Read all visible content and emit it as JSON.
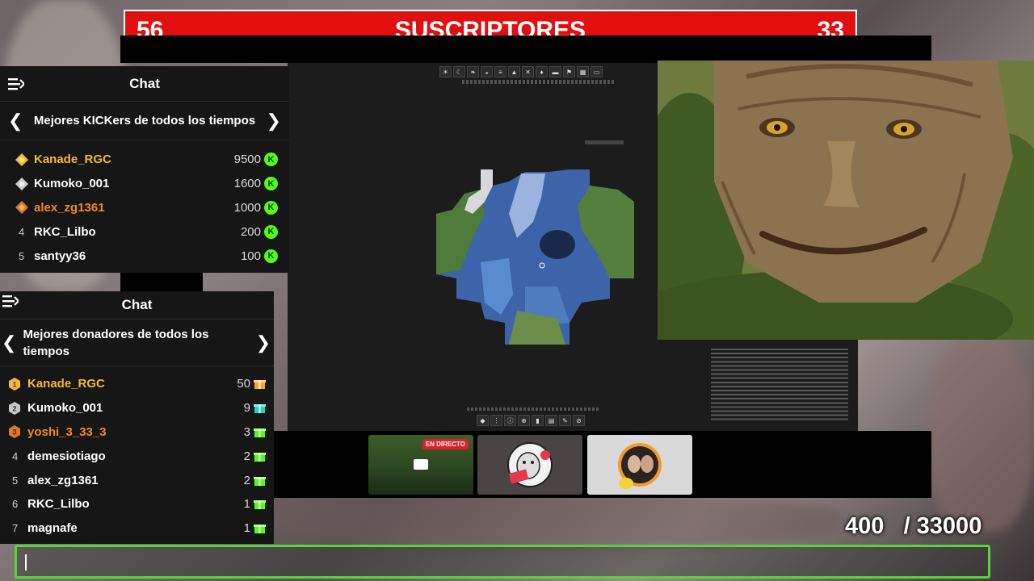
{
  "subscriber_bar": {
    "left_count": "56",
    "title": "SUSCRIPTORES",
    "right_count": "33"
  },
  "kicks_chat": {
    "header_title": "Chat",
    "leaderboard_title": "Mejores KICKers de todos los tiempos",
    "rows": [
      {
        "rank": "",
        "name": "Kanade_RGC",
        "score": "9500",
        "icon": "kick-coin"
      },
      {
        "rank": "",
        "name": "Kumoko_001",
        "score": "1600",
        "icon": "kick-coin"
      },
      {
        "rank": "",
        "name": "alex_zg1361",
        "score": "1000",
        "icon": "kick-coin"
      },
      {
        "rank": "4",
        "name": "RKC_Lilbo",
        "score": "200",
        "icon": "kick-coin"
      },
      {
        "rank": "5",
        "name": "santyy36",
        "score": "100",
        "icon": "kick-coin"
      }
    ]
  },
  "donors_chat": {
    "header_title": "Chat",
    "leaderboard_title_line1": "Mejores donadores de todos los",
    "leaderboard_title_line2": "tiempos",
    "rows": [
      {
        "rank": "1",
        "name": "Kanade_RGC",
        "score": "50",
        "icon": "gift-icon"
      },
      {
        "rank": "2",
        "name": "Kumoko_001",
        "score": "9",
        "icon": "gift-icon"
      },
      {
        "rank": "3",
        "name": "yoshi_3_33_3",
        "score": "3",
        "icon": "gift-icon"
      },
      {
        "rank": "4",
        "name": "demesiotiago",
        "score": "2",
        "icon": "gift-icon"
      },
      {
        "rank": "5",
        "name": "alex_zg1361",
        "score": "2",
        "icon": "gift-icon"
      },
      {
        "rank": "6",
        "name": "RKC_Lilbo",
        "score": "1",
        "icon": "gift-icon"
      },
      {
        "rank": "7",
        "name": "magnafe",
        "score": "1",
        "icon": "gift-icon"
      }
    ]
  },
  "map": {
    "toolbar_icons": [
      "sun-icon",
      "moon-icon",
      "leaf-icon",
      "cave-icon",
      "layers-icon",
      "fire-icon",
      "cross-icon",
      "shield-icon",
      "bed-icon",
      "flag-icon",
      "grid-icon",
      "camera-icon"
    ],
    "bottom_toolbar_icons": [
      "waypoint-icon",
      "grid-icon",
      "info-icon",
      "spawn-icon",
      "trash-icon",
      "doc-icon",
      "pen-icon",
      "eye-off-icon"
    ]
  },
  "channel_strip": {
    "live_badge": "EN DIRECTO"
  },
  "goal": {
    "current": "400",
    "target": "/ 33000"
  },
  "colors": {
    "kick_green": "#53fc18",
    "subscriber_red": "#e10f10",
    "input_border": "#52d63a",
    "top_rank_gold": "#f4b73a",
    "third_rank_orange": "#f08a24"
  }
}
